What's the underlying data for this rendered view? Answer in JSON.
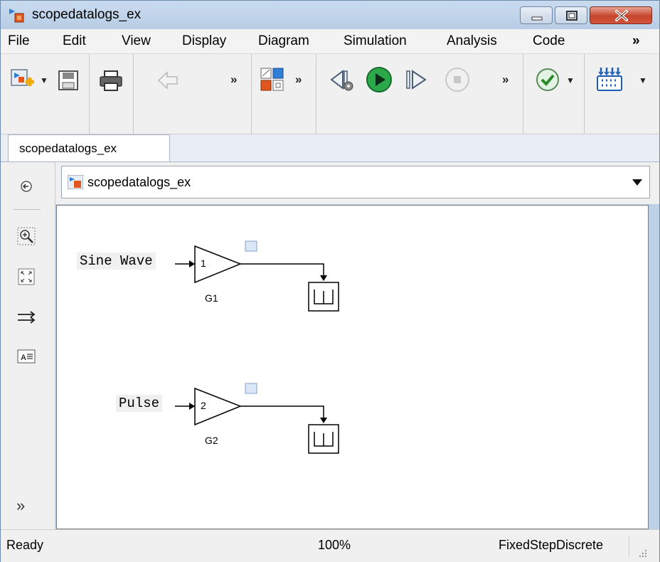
{
  "window": {
    "title": "scopedatalogs_ex"
  },
  "menu": [
    "File",
    "Edit",
    "View",
    "Display",
    "Diagram",
    "Simulation",
    "Analysis",
    "Code",
    "»"
  ],
  "toolbar": {
    "icons": [
      "new-model-icon",
      "save-icon",
      "print-icon",
      "back-arrow-icon",
      "library-browser-icon",
      "step-back-icon",
      "run-icon",
      "step-forward-icon",
      "stop-icon",
      "check-icon",
      "build-icon"
    ],
    "chevron": "»"
  },
  "tabs": [
    {
      "label": "scopedatalogs_ex"
    }
  ],
  "explorer": {
    "path": "scopedatalogs_ex"
  },
  "palette": {
    "more": "»"
  },
  "diagram": {
    "row1": {
      "source": "Sine Wave",
      "gain_value": "1",
      "gain_name": "G1"
    },
    "row2": {
      "source": "Pulse",
      "gain_value": "2",
      "gain_name": "G2"
    }
  },
  "status": {
    "state": "Ready",
    "zoom": "100%",
    "solver": "FixedStepDiscrete"
  },
  "colors": {
    "run_green": "#2aa84a",
    "window_frame": "#bcd0e6",
    "close_red": "#c5452d"
  }
}
